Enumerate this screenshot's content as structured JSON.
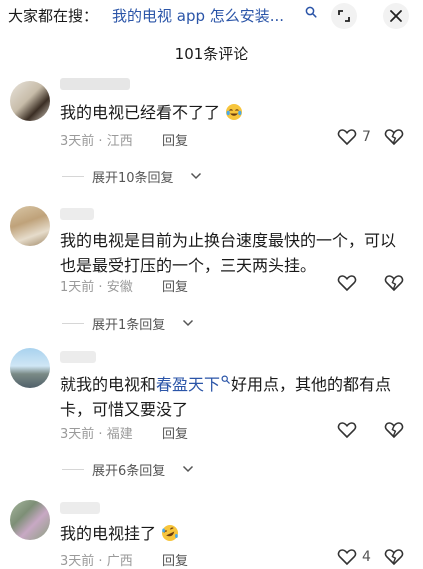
{
  "header": {
    "search_prefix": "大家都在搜：",
    "search_query": "我的电视 app 怎么安装...",
    "comment_count_title": "101条评论"
  },
  "comments": [
    {
      "text": "我的电视已经看不了了",
      "time": "3天前",
      "location": "江西",
      "reply_label": "回复",
      "likes": "7",
      "expand_label": "展开10条回复"
    },
    {
      "text": "我的电视是目前为止换台速度最快的一个，可以也是最受打压的一个，三天两头挂。",
      "time": "1天前",
      "location": "安徽",
      "reply_label": "回复",
      "likes": "",
      "expand_label": "展开1条回复"
    },
    {
      "text_before": "就我的电视和",
      "text_highlight": "春盈天下",
      "text_after": "好用点，其他的都有点卡，可惜又要没了",
      "time": "3天前",
      "location": "福建",
      "reply_label": "回复",
      "likes": "",
      "expand_label": "展开6条回复"
    },
    {
      "text": "我的电视挂了",
      "time": "3天前",
      "location": "广西",
      "reply_label": "回复",
      "likes": "4",
      "expand_label": ""
    }
  ],
  "separator": "·",
  "icons": {
    "search": "search-icon",
    "expand": "expand-icon",
    "close": "close-icon",
    "like": "heart-icon",
    "dislike": "broken-heart-icon",
    "chevron": "chevron-down-icon"
  },
  "colors": {
    "link": "#2b55a8",
    "meta": "#9a9a9a"
  }
}
